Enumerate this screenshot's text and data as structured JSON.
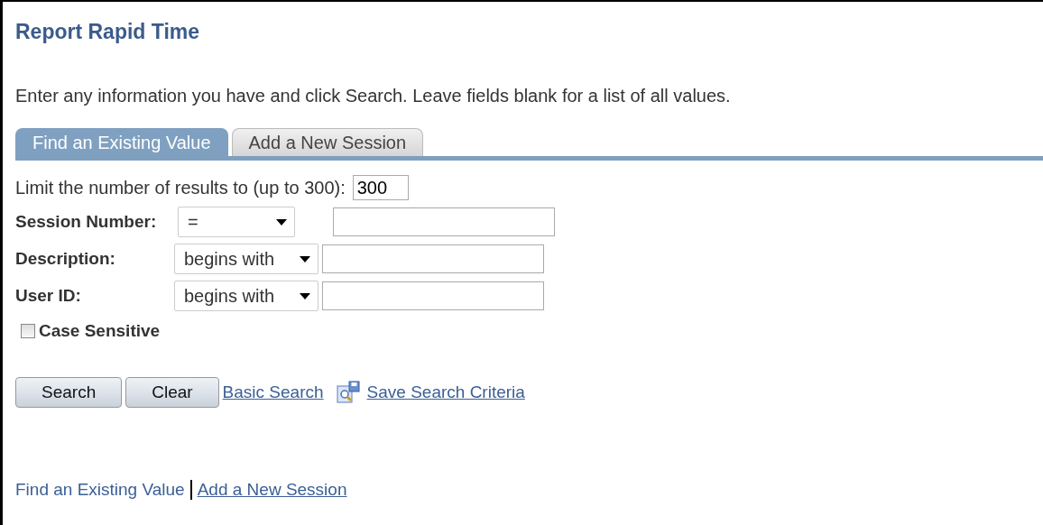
{
  "title": "Report Rapid Time",
  "instructions": "Enter any information you have and click Search. Leave fields blank for a list of all values.",
  "tabs": [
    {
      "label": "Find an Existing Value",
      "selected": true
    },
    {
      "label": "Add a New Session",
      "selected": false
    }
  ],
  "limit": {
    "label": "Limit the number of results to (up to 300):",
    "value": "300"
  },
  "criteria": [
    {
      "label": "Session Number:",
      "operator": "="
    },
    {
      "label": "Description:",
      "operator": "begins with"
    },
    {
      "label": "User ID:",
      "operator": "begins with"
    }
  ],
  "case_sensitive": {
    "label": "Case Sensitive",
    "checked": false
  },
  "buttons": [
    "Search",
    "Clear"
  ],
  "links": [
    {
      "label": "Basic Search",
      "icon": false
    },
    {
      "label": "Save Search Criteria",
      "icon": true
    }
  ],
  "footer_links": [
    {
      "label": "Find an Existing Value",
      "selected": true
    },
    {
      "label": "Add a New Session",
      "selected": false
    }
  ]
}
